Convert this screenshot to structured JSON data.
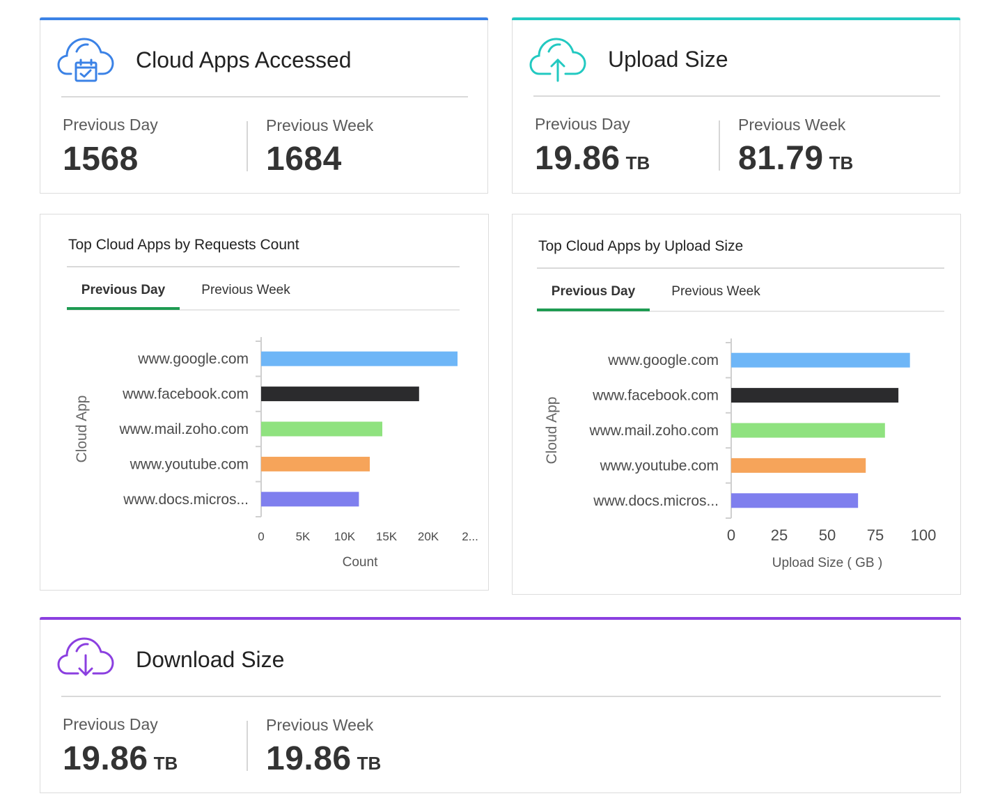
{
  "colors": {
    "cloud_apps_accent": "#3b82e6",
    "upload_accent": "#22c9c1",
    "download_accent": "#8b3fe0",
    "tab_active": "#1e9b52"
  },
  "cloud_apps_accessed": {
    "title": "Cloud Apps Accessed",
    "icon": "cloud-calendar-icon",
    "previous_day_label": "Previous Day",
    "previous_day_value": "1568",
    "previous_week_label": "Previous Week",
    "previous_week_value": "1684"
  },
  "upload_size": {
    "title": "Upload Size",
    "icon": "cloud-upload-icon",
    "previous_day_label": "Previous Day",
    "previous_day_value": "19.86",
    "previous_day_unit": "TB",
    "previous_week_label": "Previous Week",
    "previous_week_value": "81.79",
    "previous_week_unit": "TB"
  },
  "download_size": {
    "title": "Download Size",
    "icon": "cloud-download-icon",
    "previous_day_label": "Previous Day",
    "previous_day_value": "19.86",
    "previous_day_unit": "TB",
    "previous_week_label": "Previous Week",
    "previous_week_value": "19.86",
    "previous_week_unit": "TB"
  },
  "requests_panel": {
    "title": "Top Cloud Apps by Requests Count",
    "tabs": [
      {
        "label": "Previous Day",
        "active": true
      },
      {
        "label": "Previous Week",
        "active": false
      }
    ]
  },
  "upload_panel": {
    "title": "Top Cloud Apps by Upload Size",
    "tabs": [
      {
        "label": "Previous Day",
        "active": true
      },
      {
        "label": "Previous Week",
        "active": false
      }
    ]
  },
  "chart_data": [
    {
      "type": "bar",
      "orientation": "horizontal",
      "categories": [
        "www.google.com",
        "www.facebook.com",
        "www.mail.zoho.com",
        "www.youtube.com",
        "www.docs.micros..."
      ],
      "values": [
        23500,
        18900,
        14500,
        13000,
        11700
      ],
      "colors": [
        "#6eb6f7",
        "#2b2b2d",
        "#8fe27f",
        "#f6a45a",
        "#7f7fee"
      ],
      "xticks": [
        "0",
        "5K",
        "10K",
        "15K",
        "20K",
        "2..."
      ],
      "xtick_values": [
        0,
        5000,
        10000,
        15000,
        20000,
        25000
      ],
      "xlim": [
        0,
        25000
      ],
      "xlabel": "Count",
      "ylabel": "Cloud App",
      "grid": false
    },
    {
      "type": "bar",
      "orientation": "horizontal",
      "categories": [
        "www.google.com",
        "www.facebook.com",
        "www.mail.zoho.com",
        "www.youtube.com",
        "www.docs.micros..."
      ],
      "values": [
        93,
        87,
        80,
        70,
        66
      ],
      "colors": [
        "#6eb6f7",
        "#2b2b2d",
        "#8fe27f",
        "#f6a45a",
        "#7f7fee"
      ],
      "xticks": [
        "0",
        "25",
        "50",
        "75",
        "100"
      ],
      "xtick_values": [
        0,
        25,
        50,
        75,
        100
      ],
      "xlim": [
        0,
        100
      ],
      "xlabel": "Upload Size ( GB )",
      "ylabel": "Cloud App",
      "grid": false
    }
  ]
}
